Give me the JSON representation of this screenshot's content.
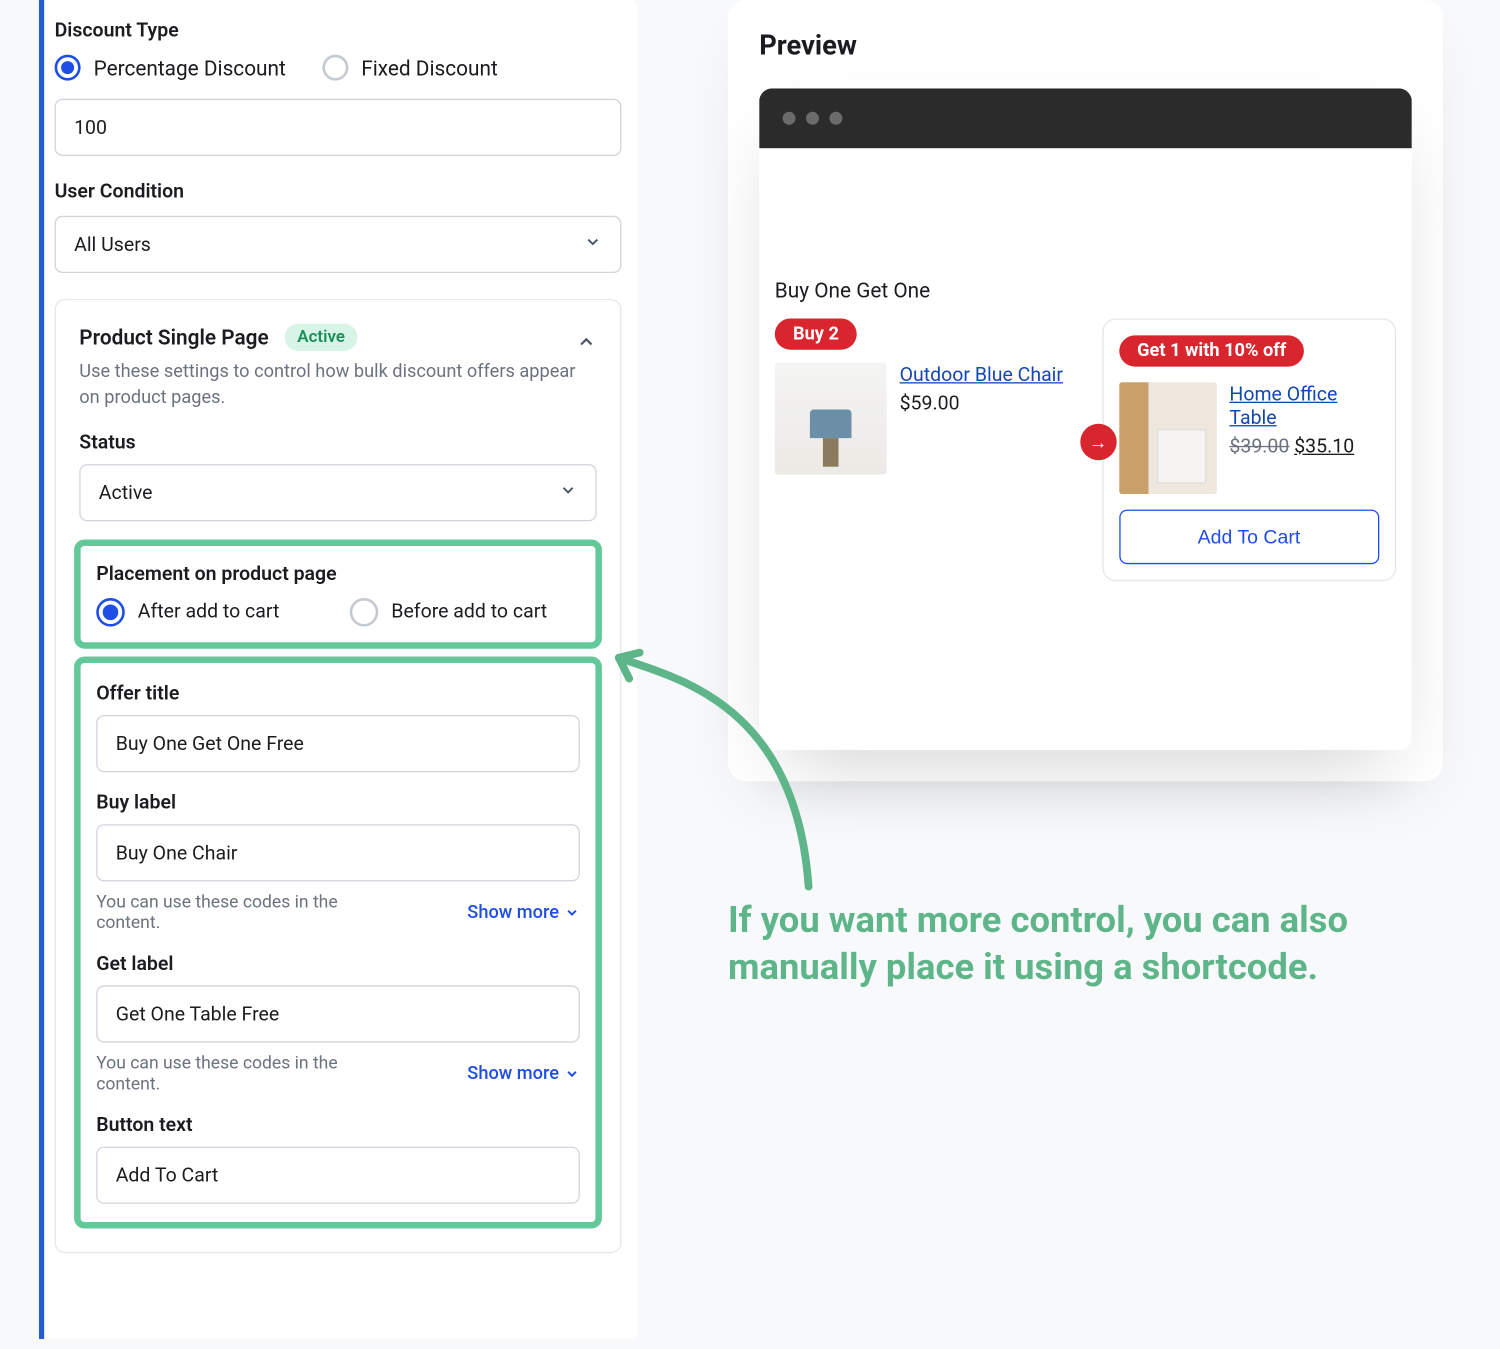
{
  "form": {
    "discount_type_label": "Discount Type",
    "percentage_label": "Percentage Discount",
    "fixed_label": "Fixed Discount",
    "discount_value": "100",
    "user_condition_label": "User Condition",
    "user_condition_value": "All Users",
    "card_title": "Product Single Page",
    "card_badge": "Active",
    "card_desc": "Use these settings to control how bulk discount offers appear on product pages.",
    "status_label": "Status",
    "status_value": "Active",
    "placement_label": "Placement on product page",
    "placement_after": "After add to cart",
    "placement_before": "Before add to cart",
    "offer_title_label": "Offer title",
    "offer_title_value": "Buy One Get One Free",
    "buy_label_label": "Buy label",
    "buy_label_value": "Buy One Chair",
    "helper_text": "You can use these codes in the content.",
    "show_more": "Show more",
    "get_label_label": "Get label",
    "get_label_value": "Get One Table Free",
    "button_text_label": "Button text",
    "button_text_value": "Add To Cart"
  },
  "preview": {
    "title": "Preview",
    "offer_heading": "Buy One Get One",
    "buy_badge": "Buy 2",
    "buy_product_name": "Outdoor Blue Chair",
    "buy_product_price": "$59.00",
    "get_badge": "Get 1 with 10% off",
    "get_product_name": "Home Office Table",
    "get_product_price_old": "$39.00",
    "get_product_price_new": "$35.10",
    "atc": "Add To Cart"
  },
  "annotation": "If you want more control, you can also manually place it using a shortcode."
}
